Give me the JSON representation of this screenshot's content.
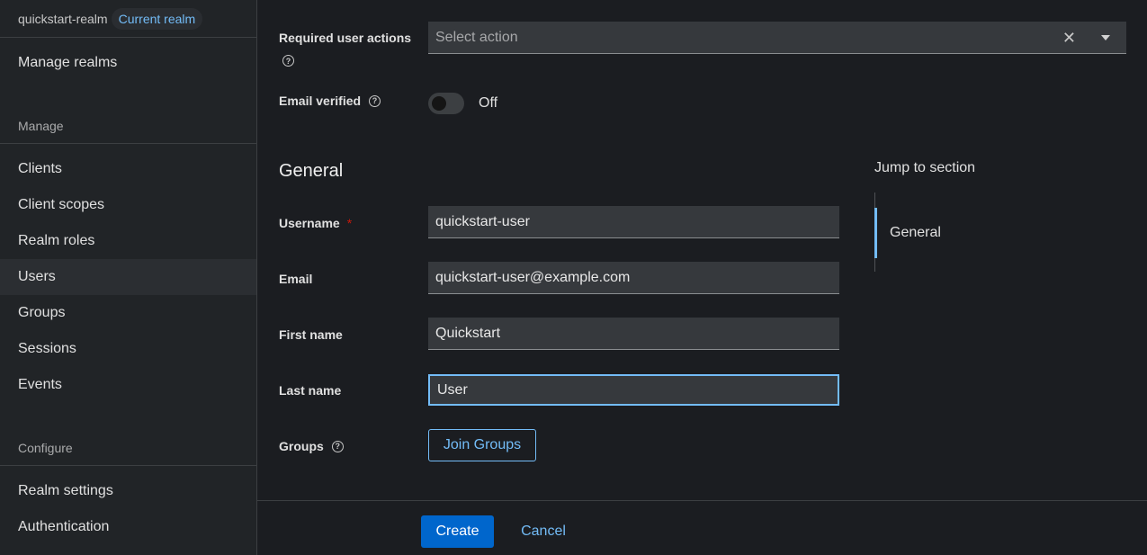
{
  "sidebar": {
    "realm_name": "quickstart-realm",
    "realm_badge": "Current realm",
    "manage_realms": "Manage realms",
    "sections": {
      "manage": "Manage",
      "configure": "Configure"
    },
    "manage_items": [
      {
        "label": "Clients"
      },
      {
        "label": "Client scopes"
      },
      {
        "label": "Realm roles"
      },
      {
        "label": "Users"
      },
      {
        "label": "Groups"
      },
      {
        "label": "Sessions"
      },
      {
        "label": "Events"
      }
    ],
    "configure_items": [
      {
        "label": "Realm settings"
      },
      {
        "label": "Authentication"
      }
    ],
    "active_item": "Users"
  },
  "form": {
    "required_actions": {
      "label": "Required user actions",
      "placeholder": "Select action"
    },
    "email_verified": {
      "label": "Email verified",
      "state_text": "Off"
    },
    "section_title": "General",
    "username": {
      "label": "Username",
      "required_mark": "*",
      "value": "quickstart-user"
    },
    "email": {
      "label": "Email",
      "value": "quickstart-user@example.com"
    },
    "first_name": {
      "label": "First name",
      "value": "Quickstart"
    },
    "last_name": {
      "label": "Last name",
      "value": "User"
    },
    "groups": {
      "label": "Groups",
      "button": "Join Groups"
    }
  },
  "jump": {
    "title": "Jump to section",
    "items": [
      {
        "label": "General"
      }
    ]
  },
  "footer": {
    "create": "Create",
    "cancel": "Cancel"
  },
  "colors": {
    "accent": "#73bcf7",
    "primary_button": "#0066cc",
    "required": "#c9190b"
  }
}
